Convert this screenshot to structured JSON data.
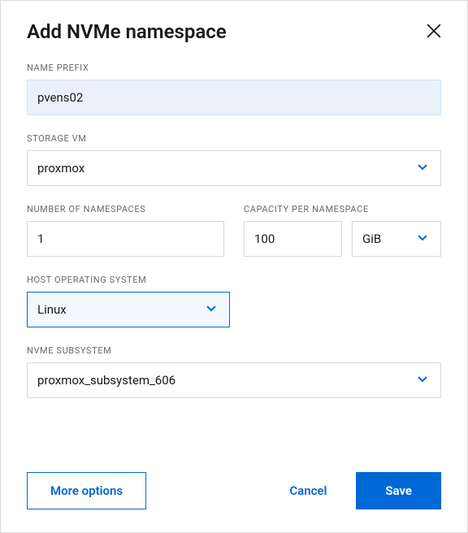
{
  "header": {
    "title": "Add NVMe namespace"
  },
  "labels": {
    "name_prefix": "NAME PREFIX",
    "storage_vm": "STORAGE VM",
    "number_of_namespaces": "NUMBER OF NAMESPACES",
    "capacity_per_namespace": "CAPACITY PER NAMESPACE",
    "host_operating_system": "HOST OPERATING SYSTEM",
    "nvme_subsystem": "NVME SUBSYSTEM"
  },
  "fields": {
    "name_prefix": {
      "value": "pvens02"
    },
    "storage_vm": {
      "value": "proxmox"
    },
    "number_of_namespaces": {
      "value": "1"
    },
    "capacity_value": {
      "value": "100"
    },
    "capacity_unit": {
      "value": "GiB"
    },
    "host_os": {
      "value": "Linux"
    },
    "nvme_subsystem": {
      "value": "proxmox_subsystem_606"
    }
  },
  "buttons": {
    "more_options": "More options",
    "cancel": "Cancel",
    "save": "Save"
  },
  "colors": {
    "accent": "#0068d6"
  }
}
